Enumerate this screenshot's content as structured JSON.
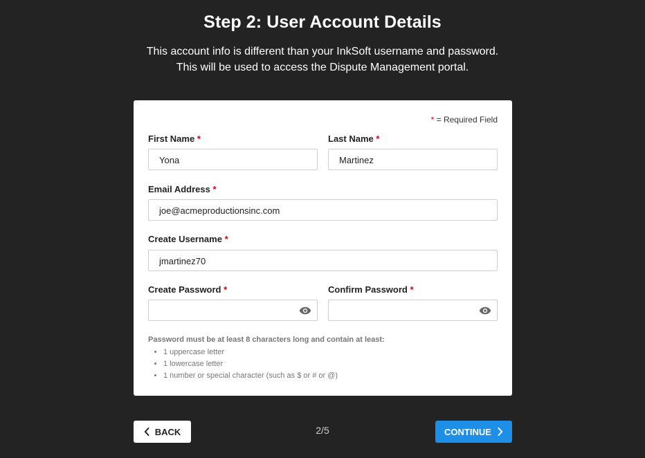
{
  "header": {
    "title": "Step 2: User Account Details",
    "subtitle_line1": "This account info is different than your InkSoft username and password.",
    "subtitle_line2": "This will be used to access the Dispute Management portal."
  },
  "form": {
    "required_star": "*",
    "required_note": "= Required Field",
    "first_name": {
      "label": "First Name",
      "value": "Yona"
    },
    "last_name": {
      "label": "Last Name",
      "value": "Martinez"
    },
    "email": {
      "label": "Email Address",
      "value": "joe@acmeproductionsinc.com"
    },
    "username": {
      "label": "Create Username",
      "value": "jmartinez70"
    },
    "password": {
      "label": "Create Password",
      "value": "",
      "icon": "eye-icon"
    },
    "confirm_password": {
      "label": "Confirm Password",
      "value": "",
      "icon": "eye-icon"
    },
    "hint": {
      "title": "Password must be at least 8 characters long and contain at least:",
      "items": [
        "1 uppercase letter",
        "1 lowercase letter",
        "1 number or special character (such as $ or # or @)"
      ]
    }
  },
  "footer": {
    "back_label": "BACK",
    "back_icon": "chevron-left-icon",
    "pager": "2/5",
    "continue_label": "CONTINUE",
    "continue_icon": "chevron-right-icon"
  },
  "colors": {
    "background": "#232323",
    "accent": "#1e8fe6",
    "required": "#d0021b"
  }
}
